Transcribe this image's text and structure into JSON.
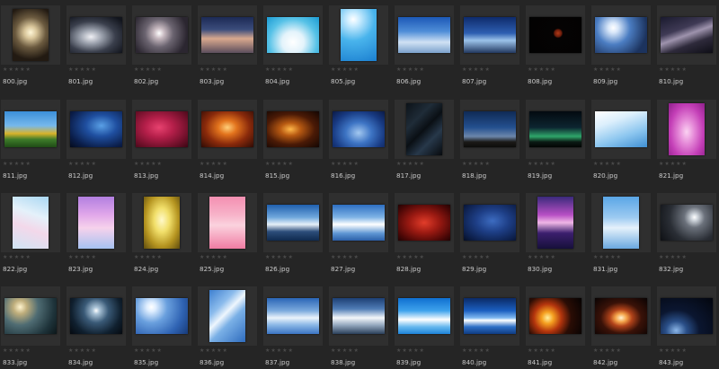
{
  "rating_empty": "★★★★★",
  "thumbnails": [
    {
      "file": "800.jpg",
      "orient": "p",
      "bg": "radial-gradient(circle at 50% 45%, #fff7d8 0%, #d8c59a 18%, #6b5a3f 45%, #221a12 80%)"
    },
    {
      "file": "801.jpg",
      "orient": "l",
      "bg": "radial-gradient(ellipse at 40% 55%, #f0f0f5 0%, #9aa0ac 25%, #3a3f4c 55%, #12151d 90%)"
    },
    {
      "file": "802.jpg",
      "orient": "l",
      "bg": "radial-gradient(circle at 45% 45%, #fff 0%, #c7b9c0 15%, #6b6470 40%, #2b2630 80%)"
    },
    {
      "file": "803.jpg",
      "orient": "l",
      "bg": "linear-gradient(180deg, #1c2a55 0%, #3c4d7c 35%, #d9a98e 60%, #5b4d5c 100%)"
    },
    {
      "file": "804.jpg",
      "orient": "l",
      "bg": "radial-gradient(ellipse at 50% 70%, #ffffff 0%, #e3f3fb 30%, #57c2e7 65%, #1a9ad3 100%)"
    },
    {
      "file": "805.jpg",
      "orient": "p",
      "bg": "radial-gradient(circle at 35% 20%, #ffffff 0%, #cfeeff 12%, #49b4ec 45%, #1b7fd0 100%)"
    },
    {
      "file": "806.jpg",
      "orient": "l",
      "bg": "linear-gradient(180deg, #1c58b6 0%, #4f8ed8 40%, #d0e2f4 70%, #7ba1cc 100%)"
    },
    {
      "file": "807.jpg",
      "orient": "l",
      "bg": "linear-gradient(180deg, #0e2b6b 0%, #2e5fb2 45%, #9cc3ea 65%, #22385f 100%)"
    },
    {
      "file": "808.jpg",
      "orient": "l",
      "bg": "radial-gradient(circle at 55% 45%, #b23b18 0%, #6b1c0b 10%, #050303 14%, #020202 100%)"
    },
    {
      "file": "809.jpg",
      "orient": "l",
      "bg": "radial-gradient(circle at 35% 30%, #ffffff 0%, #d7e6f9 12%, #4b7dc2 40%, #1c335e 80%)"
    },
    {
      "file": "810.jpg",
      "orient": "l",
      "bg": "linear-gradient(160deg, #1a1a2e 0%, #3f3a55 35%, #9e93ad 50%, #2e2a3b 70%, #0e0e16 100%)"
    },
    {
      "file": "811.jpg",
      "orient": "l",
      "bg": "linear-gradient(180deg, #3b8fd9 0%, #76b8ec 40%, #d8b32a 62%, #3e7c2a 78%, #1f4b16 100%)"
    },
    {
      "file": "812.jpg",
      "orient": "l",
      "bg": "radial-gradient(ellipse at 60% 40%, #5aa0e6 0%, #1f4fa0 35%, #0b1e4a 75%, #050b1c 100%)"
    },
    {
      "file": "813.jpg",
      "orient": "l",
      "bg": "radial-gradient(ellipse at 45% 45%, #e7426f 0%, #b51f4a 35%, #6b0f28 75%, #3a0714 100%)"
    },
    {
      "file": "814.jpg",
      "orient": "l",
      "bg": "radial-gradient(ellipse at 50% 45%, #ffcf7a 0%, #e3741d 25%, #8a2a0b 60%, #2e0b05 100%)"
    },
    {
      "file": "815.jpg",
      "orient": "l",
      "bg": "radial-gradient(ellipse at 45% 50%, #ffb84a 0%, #b85a12 25%, #4a1a06 60%, #130603 100%)"
    },
    {
      "file": "816.jpg",
      "orient": "l",
      "bg": "radial-gradient(ellipse at 50% 60%, #a3c8f0 0%, #3d74c4 35%, #183a82 70%, #0b1a45 100%)"
    },
    {
      "file": "817.jpg",
      "orient": "p",
      "bg": "linear-gradient(135deg, #0c1218 0%, #1f2c38 30%, #0a0f14 50%, #27384a 70%, #070a0e 100%)"
    },
    {
      "file": "818.jpg",
      "orient": "l",
      "bg": "linear-gradient(180deg, #0f2a55 0%, #24508f 45%, #6c86ab 70%, #1b1a18 85%, #0d0c0a 100%)"
    },
    {
      "file": "819.jpg",
      "orient": "l",
      "bg": "linear-gradient(180deg, #030a10 0%, #0d2530 45%, #2fa66a 70%, #0b1a14 85%, #020403 100%)"
    },
    {
      "file": "820.jpg",
      "orient": "l",
      "bg": "linear-gradient(160deg, #ffffff 0%, #dceffc 30%, #8cc6ef 65%, #3f8fd2 100%)"
    },
    {
      "file": "821.jpg",
      "orient": "p",
      "bg": "radial-gradient(ellipse at 50% 55%, #fbd2f2 0%, #e58ad8 30%, #c43fb7 65%, #8e1f8a 100%)"
    },
    {
      "file": "822.jpg",
      "orient": "p",
      "bg": "linear-gradient(200deg, #a9d7f2 0%, #e4f1fa 35%, #f3d8ea 60%, #cfe4f4 100%)"
    },
    {
      "file": "823.jpg",
      "orient": "p",
      "bg": "linear-gradient(180deg, #b27fe0 0%, #e1a8ea 35%, #f6d2ec 60%, #a6c2f0 100%)"
    },
    {
      "file": "824.jpg",
      "orient": "p",
      "bg": "radial-gradient(ellipse at 50% 45%, #fff9c9 0%, #f1df6a 30%, #b59420 65%, #5e4b0e 100%)"
    },
    {
      "file": "825.jpg",
      "orient": "p",
      "bg": "linear-gradient(180deg, #f48fb1 0%, #f7b3c9 35%, #fbd2de 55%, #f07ca3 100%)"
    },
    {
      "file": "826.jpg",
      "orient": "l",
      "bg": "linear-gradient(180deg, #1f5fae 0%, #6fa7dc 35%, #e6f0f8 55%, #2c4d7a 75%, #0f2a4f 100%)"
    },
    {
      "file": "827.jpg",
      "orient": "l",
      "bg": "linear-gradient(180deg, #2d6fc2 0%, #7fb3e6 35%, #ffffff 55%, #5d95d3 80%, #2b5fa8 100%)"
    },
    {
      "file": "828.jpg",
      "orient": "l",
      "bg": "radial-gradient(ellipse at 50% 50%, #e23d2a 0%, #9c1a12 40%, #4a0706 80%, #220303 100%)"
    },
    {
      "file": "829.jpg",
      "orient": "l",
      "bg": "radial-gradient(ellipse at 55% 45%, #3d6cc1 0%, #1e3f87 40%, #0d1f4a 80%, #060e24 100%)"
    },
    {
      "file": "830.jpg",
      "orient": "p",
      "bg": "linear-gradient(180deg, #3b2a7c 0%, #b74fc4 35%, #f0b7e6 50%, #3c1f6e 70%, #16103a 100%)"
    },
    {
      "file": "831.jpg",
      "orient": "p",
      "bg": "linear-gradient(180deg, #5aa6e6 0%, #9ccaf1 40%, #e5f1fb 60%, #6aa8e0 100%)"
    },
    {
      "file": "832.jpg",
      "orient": "l",
      "bg": "radial-gradient(circle at 65% 35%, #ffffff 0%, #cfd5dc 8%, #6b717b 25%, #2a2e35 60%, #0e1014 100%)"
    },
    {
      "file": "833.jpg",
      "orient": "l",
      "bg": "radial-gradient(circle at 30% 25%, #fff4cf 0%, #bfae7c 15%, #4f6c73 40%, #1e333a 75%, #0c1619 100%)"
    },
    {
      "file": "834.jpg",
      "orient": "l",
      "bg": "radial-gradient(circle at 50% 35%, #ffffff 0%, #a9c2d6 10%, #3a5a77 35%, #10202f 70%, #05090f 100%)"
    },
    {
      "file": "835.jpg",
      "orient": "l",
      "bg": "radial-gradient(circle at 30% 25%, #ffffff 0%, #dfeeff 10%, #6aa0de 35%, #2f63b3 70%, #173a78 100%)"
    },
    {
      "file": "836.jpg",
      "orient": "p",
      "bg": "linear-gradient(135deg, #3d7fd0 0%, #8cbcec 30%, #eef6fd 45%, #7ab0e6 60%, #2f6cbe 100%)"
    },
    {
      "file": "837.jpg",
      "orient": "l",
      "bg": "linear-gradient(180deg, #2a65b6 0%, #7aa9dd 35%, #eaf3fb 55%, #8ab7e6 75%, #3b74c2 100%)"
    },
    {
      "file": "838.jpg",
      "orient": "l",
      "bg": "linear-gradient(180deg, #1d3f74 0%, #4f7cb5 30%, #f4f7fa 55%, #95a9bf 75%, #2a3f5a 100%)"
    },
    {
      "file": "839.jpg",
      "orient": "l",
      "bg": "linear-gradient(180deg, #0f6fd0 0%, #3ea2ec 35%, #ffffff 60%, #67b8ee 80%, #1e83d8 100%)"
    },
    {
      "file": "840.jpg",
      "orient": "l",
      "bg": "linear-gradient(180deg, #0b2a66 0%, #1b5fc0 35%, #7fb8f0 55%, #ffffff 62%, #2d6fc6 80%, #0f3b82 100%)"
    },
    {
      "file": "841.jpg",
      "orient": "l",
      "bg": "radial-gradient(circle at 35% 55%, #fff0a0 0%, #f5a020 15%, #b4350d 35%, #2a0d05 60%, #050202 100%)"
    },
    {
      "file": "842.jpg",
      "orient": "l",
      "bg": "radial-gradient(ellipse at 50% 55%, #fff3d0 0%, #f4a34a 15%, #b1431a 30%, #3a1208 55%, #080303 100%)"
    },
    {
      "file": "843.jpg",
      "orient": "l",
      "bg": "radial-gradient(ellipse at 30% 90%, #8bb6e8 0%, #2a4f88 20%, #0b1630 45%, #03060e 100%)"
    }
  ]
}
